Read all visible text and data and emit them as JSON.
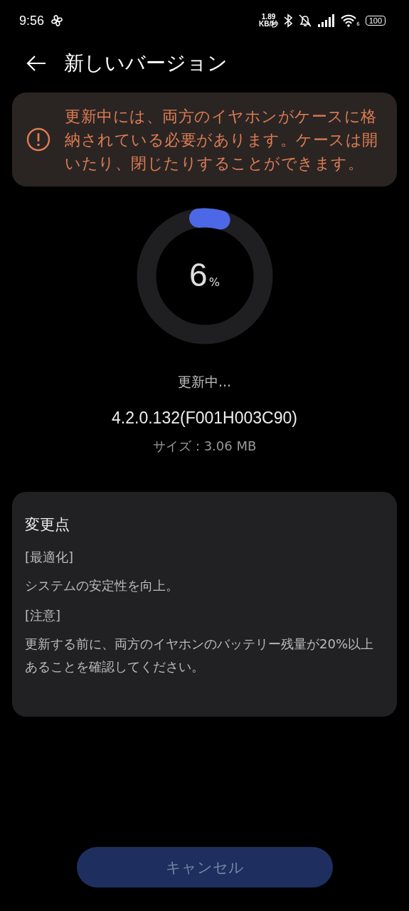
{
  "status_bar": {
    "time": "9:56",
    "speed_value": "1.89",
    "speed_unit": "KB/秒",
    "wifi_number": "6",
    "battery": "100"
  },
  "header": {
    "title": "新しいバージョン"
  },
  "warning": {
    "text": "更新中には、両方のイヤホンがケースに格納されている必要があります。ケースは開いたり、閉じたりすることができます。"
  },
  "progress": {
    "value": "6",
    "unit": "%"
  },
  "status_text": "更新中...",
  "version": "4.2.0.132(F001H003C90)",
  "size": "サイズ：3.06 MB",
  "changes": {
    "title": "変更点",
    "sections": [
      {
        "heading": "[最適化]",
        "body": "システムの安定性を向上。"
      },
      {
        "heading": "[注意]",
        "body": "更新する前に、両方のイヤホンのバッテリー残量が20%以上あることを確認してください。"
      }
    ]
  },
  "buttons": [
    {
      "label": "キャンセル"
    }
  ]
}
